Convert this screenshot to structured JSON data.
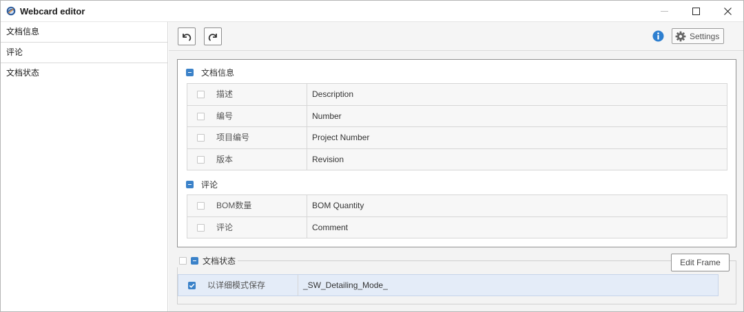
{
  "window": {
    "title": "Webcard editor"
  },
  "sidebar": {
    "items": [
      {
        "label": "文档信息"
      },
      {
        "label": "评论"
      },
      {
        "label": "文档状态"
      }
    ]
  },
  "toolbar": {
    "settings_label": "Settings"
  },
  "groups": [
    {
      "label": "文档信息",
      "rows": [
        {
          "label": "描述",
          "value": "Description"
        },
        {
          "label": "编号",
          "value": "Number"
        },
        {
          "label": "项目编号",
          "value": "Project Number"
        },
        {
          "label": "版本",
          "value": "Revision"
        }
      ]
    },
    {
      "label": "评论",
      "rows": [
        {
          "label": "BOM数量",
          "value": "BOM Quantity"
        },
        {
          "label": "评论",
          "value": "Comment"
        }
      ]
    }
  ],
  "frame2": {
    "label": "文档状态",
    "edit_label": "Edit Frame",
    "rows": [
      {
        "label": "以详细模式保存",
        "value": "_SW_Detailing_Mode_",
        "checked": true
      }
    ]
  },
  "colors": {
    "accent": "#3b82c9",
    "selected_row": "#e4ecf8"
  }
}
